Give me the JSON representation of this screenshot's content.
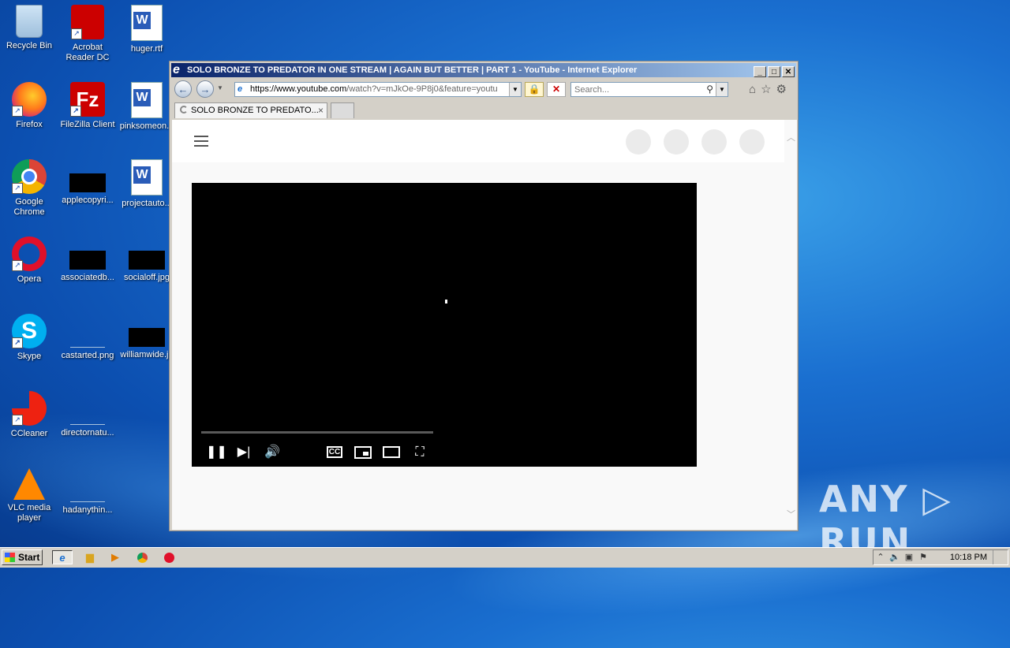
{
  "desktop": {
    "icons": [
      {
        "label": "Recycle Bin"
      },
      {
        "label": "Acrobat Reader DC"
      },
      {
        "label": "huger.rtf"
      },
      {
        "label": "Firefox"
      },
      {
        "label": "FileZilla Client"
      },
      {
        "label": "pinksomeon..."
      },
      {
        "label": "Google Chrome"
      },
      {
        "label": "applecopyri..."
      },
      {
        "label": "projectauto..."
      },
      {
        "label": "Opera"
      },
      {
        "label": "associatedb..."
      },
      {
        "label": "socialoff.jpg"
      },
      {
        "label": "Skype"
      },
      {
        "label": "castarted.png"
      },
      {
        "label": "williamwide.jp"
      },
      {
        "label": "CCleaner"
      },
      {
        "label": "directornatu..."
      },
      {
        "label": "VLC media player"
      },
      {
        "label": "hadanythin..."
      }
    ],
    "watermark": "ANY ▷ RUN"
  },
  "window": {
    "title": "SOLO BRONZE TO PREDATOR IN ONE STREAM | AGAIN BUT BETTER | PART 1 - YouTube - Internet Explorer",
    "address_domain": "https://www.youtube.com",
    "address_path": "/watch?v=mJkOe-9P8j0&feature=youtu",
    "search_placeholder": "Search...",
    "tab_label": "SOLO BRONZE TO PREDATO...",
    "tab_close": "×"
  },
  "taskbar": {
    "start_label": "Start",
    "clock": "10:18 PM"
  },
  "colors": {
    "title_bar": "#0a246a",
    "desktop": "#1a6fd0",
    "player": "#000000"
  }
}
